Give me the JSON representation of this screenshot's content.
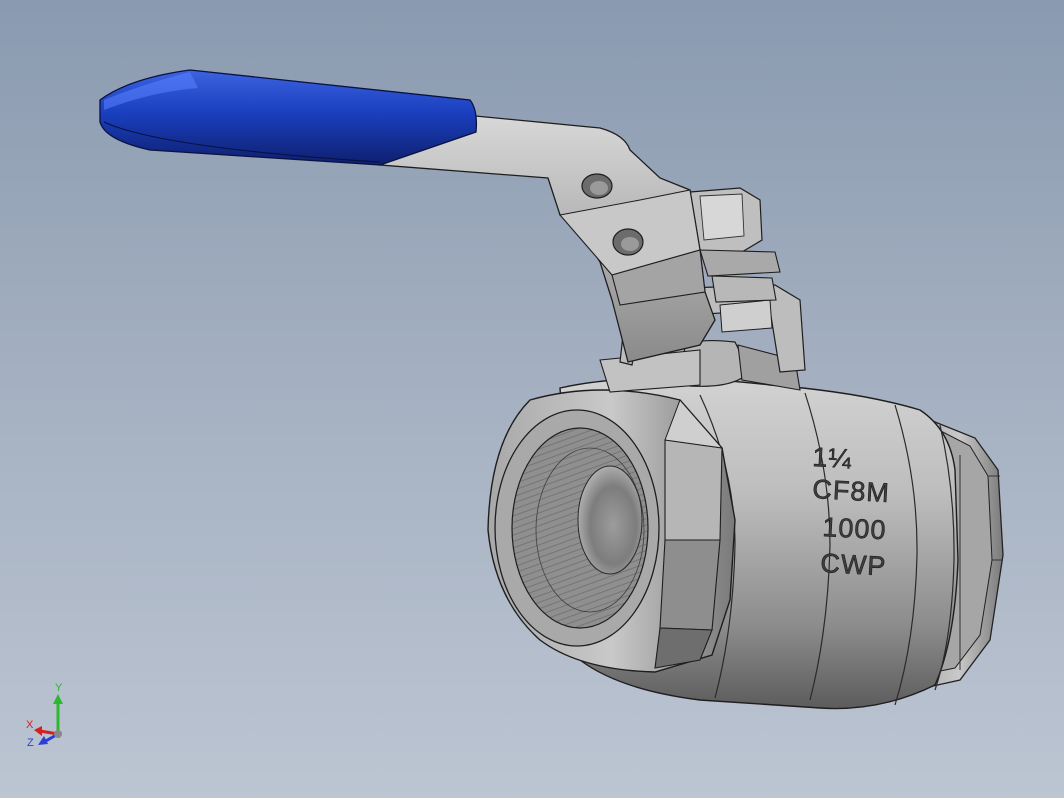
{
  "viewport": {
    "background_top": "#8a9ab0",
    "background_bottom": "#bcc5d2"
  },
  "model": {
    "handle_grip_color": "#1a3fbf",
    "body_color": "#9a9a9a",
    "markings": {
      "size": "1¼",
      "material": "CF8M",
      "pressure": "1000",
      "rating": "CWP"
    }
  },
  "triad": {
    "x_label": "X",
    "y_label": "Y",
    "z_label": "Z",
    "x_color": "#d62020",
    "y_color": "#2eb82e",
    "z_color": "#2a3fd6"
  }
}
